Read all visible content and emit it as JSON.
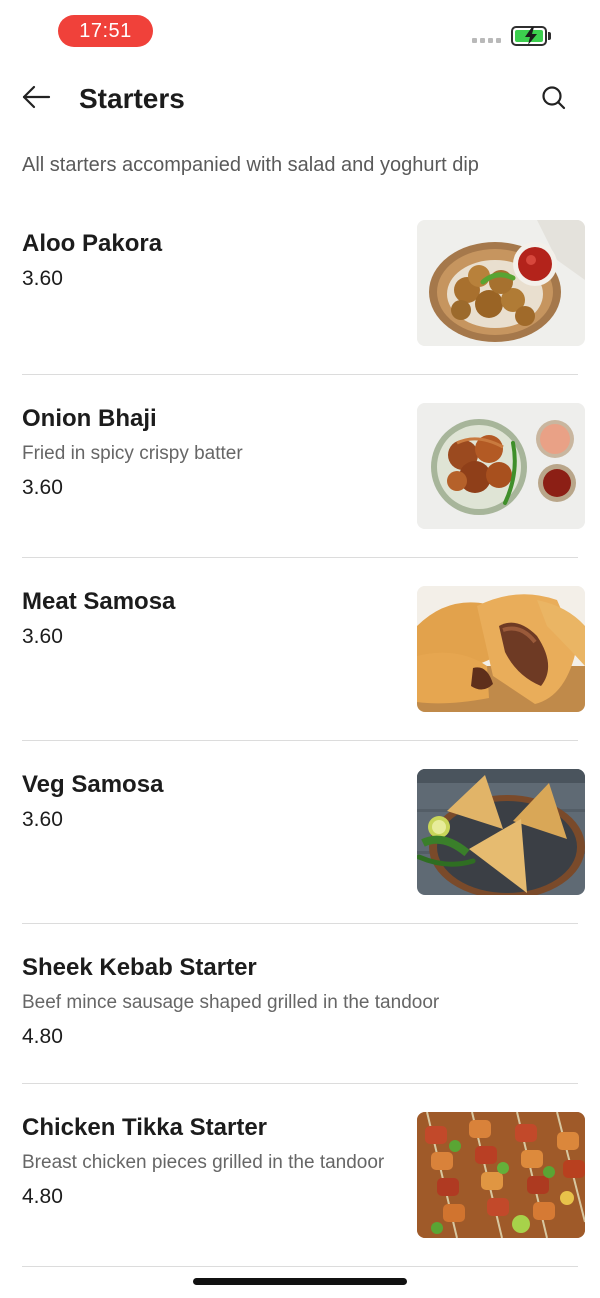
{
  "status_bar": {
    "time": "17:51",
    "battery_color": "#3ccf4e",
    "time_pill_color": "#f0413a"
  },
  "header": {
    "title": "Starters",
    "back_icon": "arrow-left-icon",
    "search_icon": "search-icon"
  },
  "subtitle": "All starters accompanied with salad and yoghurt dip",
  "items": [
    {
      "name": "Aloo Pakora",
      "description": "",
      "price": "3.60",
      "image": "aloo-pakora-photo"
    },
    {
      "name": "Onion Bhaji",
      "description": "Fried in spicy crispy batter",
      "price": "3.60",
      "image": "onion-bhaji-photo"
    },
    {
      "name": "Meat Samosa",
      "description": "",
      "price": "3.60",
      "image": "meat-samosa-photo"
    },
    {
      "name": "Veg Samosa",
      "description": "",
      "price": "3.60",
      "image": "veg-samosa-photo"
    },
    {
      "name": "Sheek Kebab Starter",
      "description": "Beef mince sausage shaped grilled in the tandoor",
      "price": "4.80",
      "image": ""
    },
    {
      "name": "Chicken Tikka Starter",
      "description": "Breast chicken pieces grilled in the tandoor",
      "price": "4.80",
      "image": "chicken-tikka-photo"
    }
  ]
}
